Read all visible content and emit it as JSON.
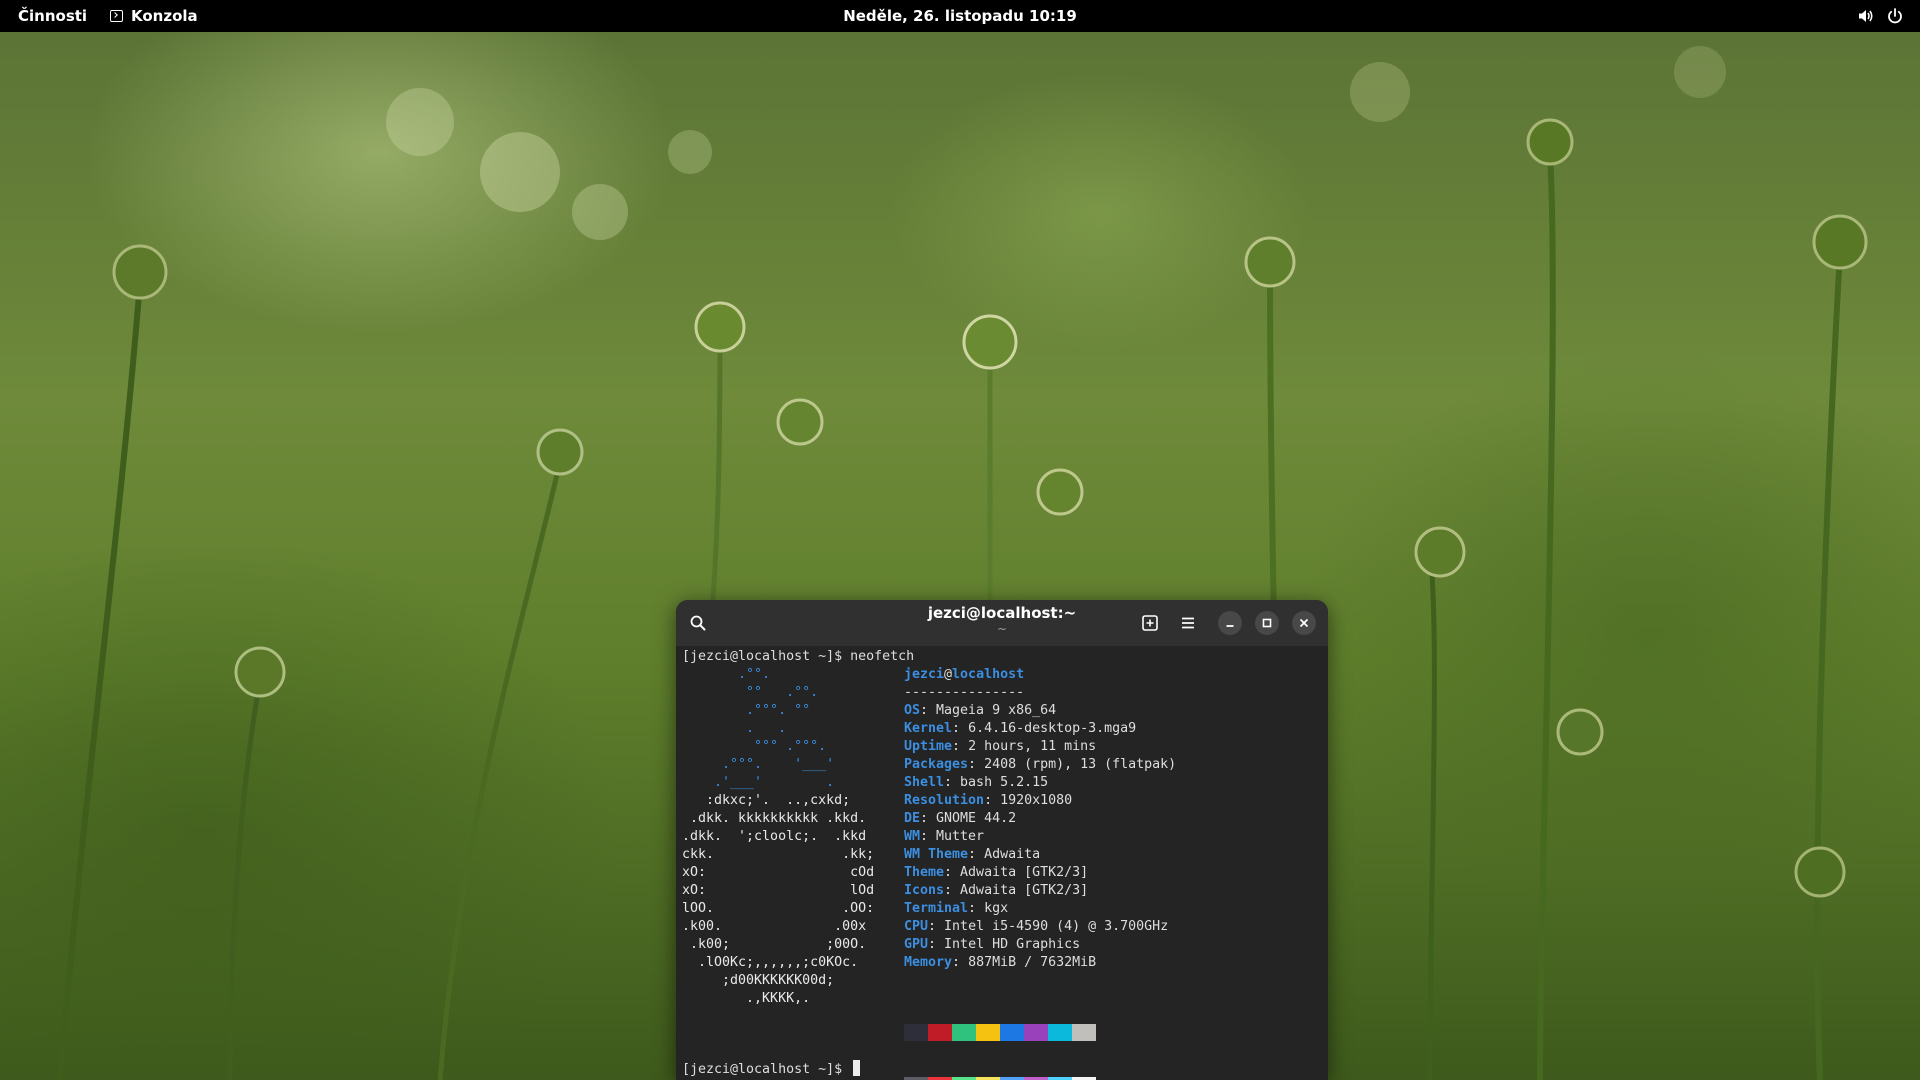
{
  "topbar": {
    "activities": "Činnosti",
    "app_name": "Konzola",
    "clock": "Neděle, 26. listopadu  10:19",
    "sound_icon": "speaker-icon",
    "power_icon": "power-icon"
  },
  "terminal": {
    "title": "jezci@localhost:~",
    "subtitle": "~",
    "prompt_command": "[jezci@localhost ~]$ neofetch",
    "prompt_final": "[jezci@localhost ~]$ ",
    "logo_lines": [
      "       .°°.",
      "        °°   .°°.",
      "        .°°°. °°",
      "        .   .",
      "         °°° .°°°.",
      "     .°°°.    '___'",
      "    .'___'        .",
      "   :dkxc;'.  ..,cxkd;",
      " .dkk. kkkkkkkkkk .kkd.",
      ".dkk.  ';cloolc;.  .kkd",
      "ckk.                .kk;",
      "xO:                  cOd",
      "xO:                  lOd",
      "lOO.                .OO:",
      ".k00.              .00x",
      " .k00;            ;00O.",
      "  .lO0Kc;,,,,,,;c0KOc.",
      "     ;d00KKKKKK00d;",
      "        .,KKKK,."
    ],
    "info_user": "jezci",
    "info_at": "@",
    "info_host": "localhost",
    "info_sep": "---------------",
    "info": [
      {
        "key": "OS",
        "value": "Mageia 9 x86_64"
      },
      {
        "key": "Kernel",
        "value": "6.4.16-desktop-3.mga9"
      },
      {
        "key": "Uptime",
        "value": "2 hours, 11 mins"
      },
      {
        "key": "Packages",
        "value": "2408 (rpm), 13 (flatpak)"
      },
      {
        "key": "Shell",
        "value": "bash 5.2.15"
      },
      {
        "key": "Resolution",
        "value": "1920x1080"
      },
      {
        "key": "DE",
        "value": "GNOME 44.2"
      },
      {
        "key": "WM",
        "value": "Mutter"
      },
      {
        "key": "WM Theme",
        "value": "Adwaita"
      },
      {
        "key": "Theme",
        "value": "Adwaita [GTK2/3]"
      },
      {
        "key": "Icons",
        "value": "Adwaita [GTK2/3]"
      },
      {
        "key": "Terminal",
        "value": "kgx"
      },
      {
        "key": "CPU",
        "value": "Intel i5-4590 (4) @ 3.700GHz"
      },
      {
        "key": "GPU",
        "value": "Intel HD Graphics"
      },
      {
        "key": "Memory",
        "value": "887MiB / 7632MiB"
      }
    ],
    "palette_top": [
      "#2e2e3a",
      "#c01c28",
      "#2ec27e",
      "#f5c211",
      "#1e78e4",
      "#9841bb",
      "#0ab9dc",
      "#c0bfbc"
    ],
    "palette_bottom": [
      "#5e5c64",
      "#ed333b",
      "#57e389",
      "#f8e45c",
      "#51a1ff",
      "#c061cb",
      "#4fd2fd",
      "#f6f5f4"
    ]
  }
}
